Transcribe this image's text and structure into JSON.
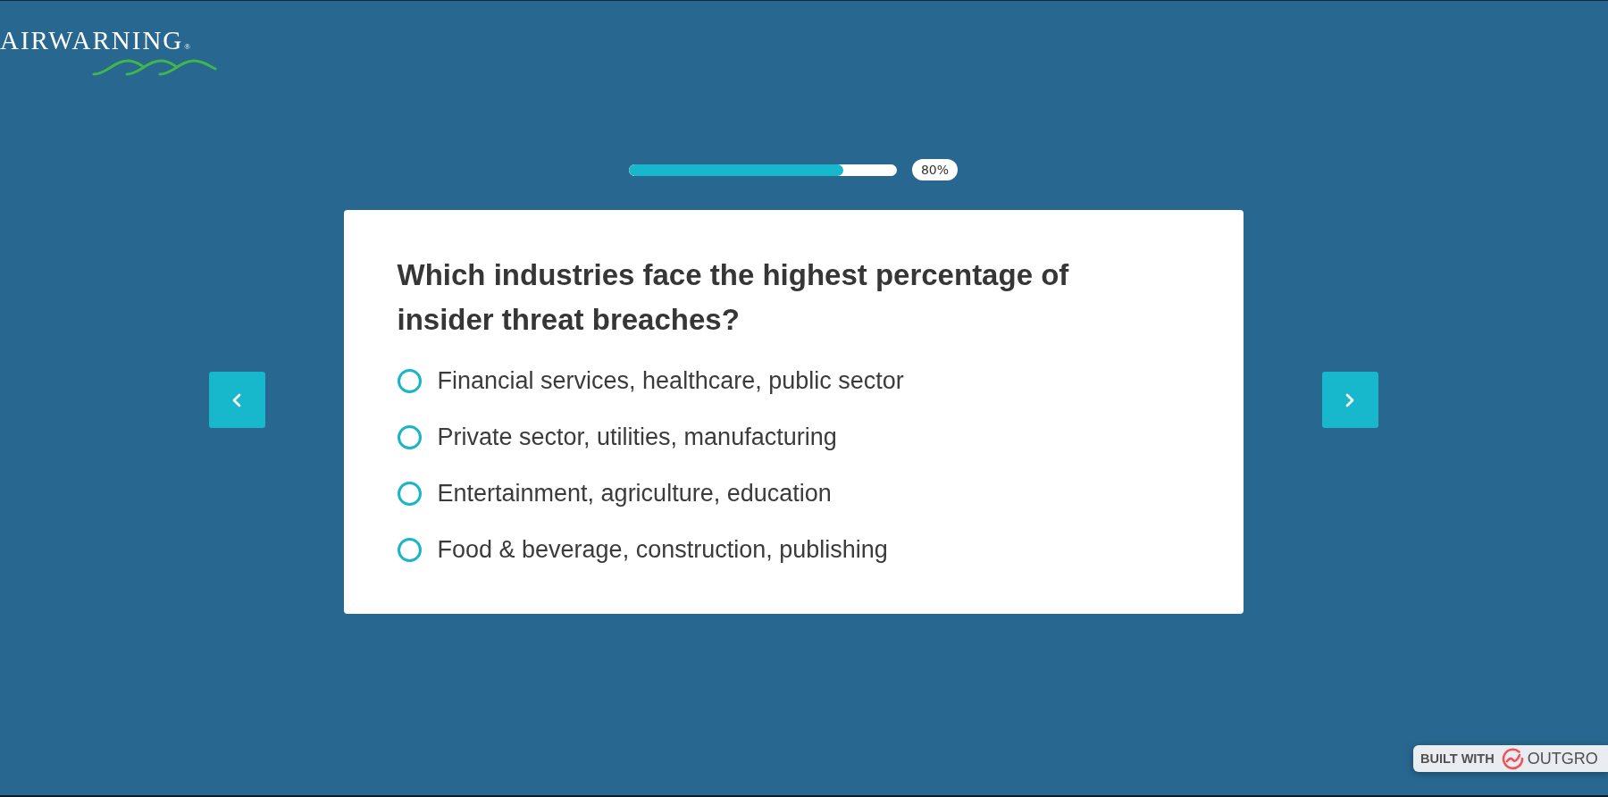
{
  "logo": {
    "text": "AIRWARNING",
    "mark": "®"
  },
  "progress": {
    "level": 0.8,
    "label": "80%"
  },
  "question": {
    "title": "Which industries face the highest percentage of insider threat breaches?",
    "options": [
      {
        "label": "Financial services, healthcare, public sector",
        "selected": false
      },
      {
        "label": "Private sector, utilities, manufacturing",
        "selected": false
      },
      {
        "label": "Entertainment, agriculture, education",
        "selected": false
      },
      {
        "label": "Food & beverage, construction, publishing",
        "selected": false
      }
    ]
  },
  "badge": {
    "prefix": "BUILT WITH",
    "brand": "OUTGRO"
  }
}
